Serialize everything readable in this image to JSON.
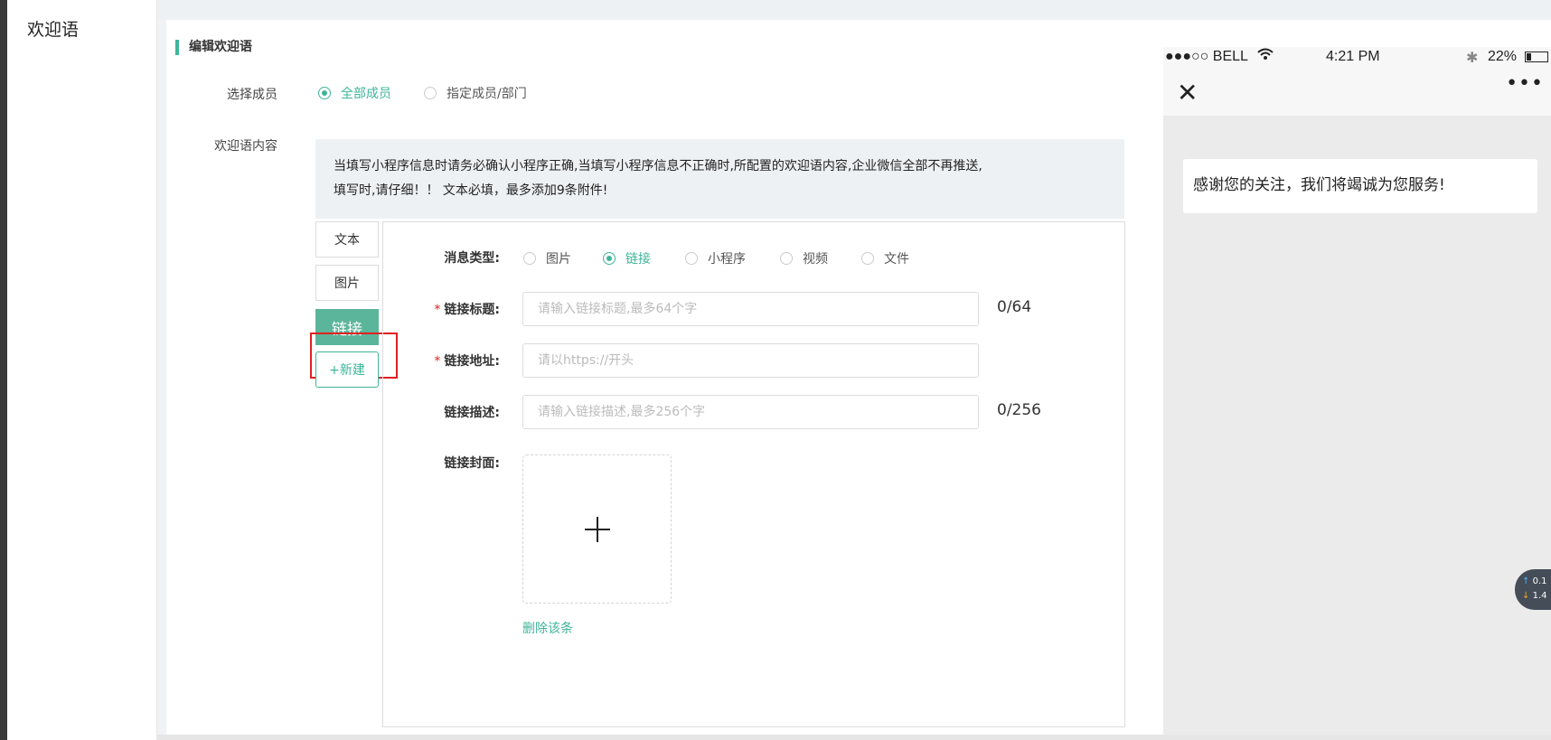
{
  "sidebar": {
    "title": "欢迎语"
  },
  "section": {
    "title": "编辑欢迎语"
  },
  "member_select": {
    "label": "选择成员",
    "options": [
      {
        "label": "全部成员",
        "selected": true
      },
      {
        "label": "指定成员/部门",
        "selected": false
      }
    ]
  },
  "content": {
    "label": "欢迎语内容",
    "notice_line1": "当填写小程序信息时请务必确认小程序正确,当填写小程序信息不正确时,所配置的欢迎语内容,企业微信全部不再推送,",
    "notice_line2": "填写时,请仔细！！ 文本必填，最多添加9条附件!"
  },
  "tabs": {
    "text": "文本",
    "image": "图片",
    "link": "链接",
    "new": "+新建"
  },
  "message_type": {
    "label": "消息类型:",
    "options": [
      {
        "label": "图片",
        "selected": false
      },
      {
        "label": "链接",
        "selected": true
      },
      {
        "label": "小程序",
        "selected": false
      },
      {
        "label": "视频",
        "selected": false
      },
      {
        "label": "文件",
        "selected": false
      }
    ]
  },
  "form": {
    "required_mark": "*",
    "title_label": "链接标题:",
    "title_placeholder": "请输入链接标题,最多64个字",
    "title_counter": "0/64",
    "url_label": "链接地址:",
    "url_placeholder": "请以https://开头",
    "desc_label": "链接描述:",
    "desc_placeholder": "请输入链接描述,最多256个字",
    "desc_counter": "0/256",
    "cover_label": "链接封面:",
    "delete_label": "删除该条"
  },
  "phone": {
    "carrier": "●●●○○ BELL",
    "time": "4:21 PM",
    "battery": "22%",
    "message": "感谢您的关注，我们将竭诚为您服务!"
  },
  "speed": {
    "up": "0.1",
    "down": "1.4"
  },
  "colors": {
    "accent": "#3fb499",
    "highlight": "#e02020"
  }
}
